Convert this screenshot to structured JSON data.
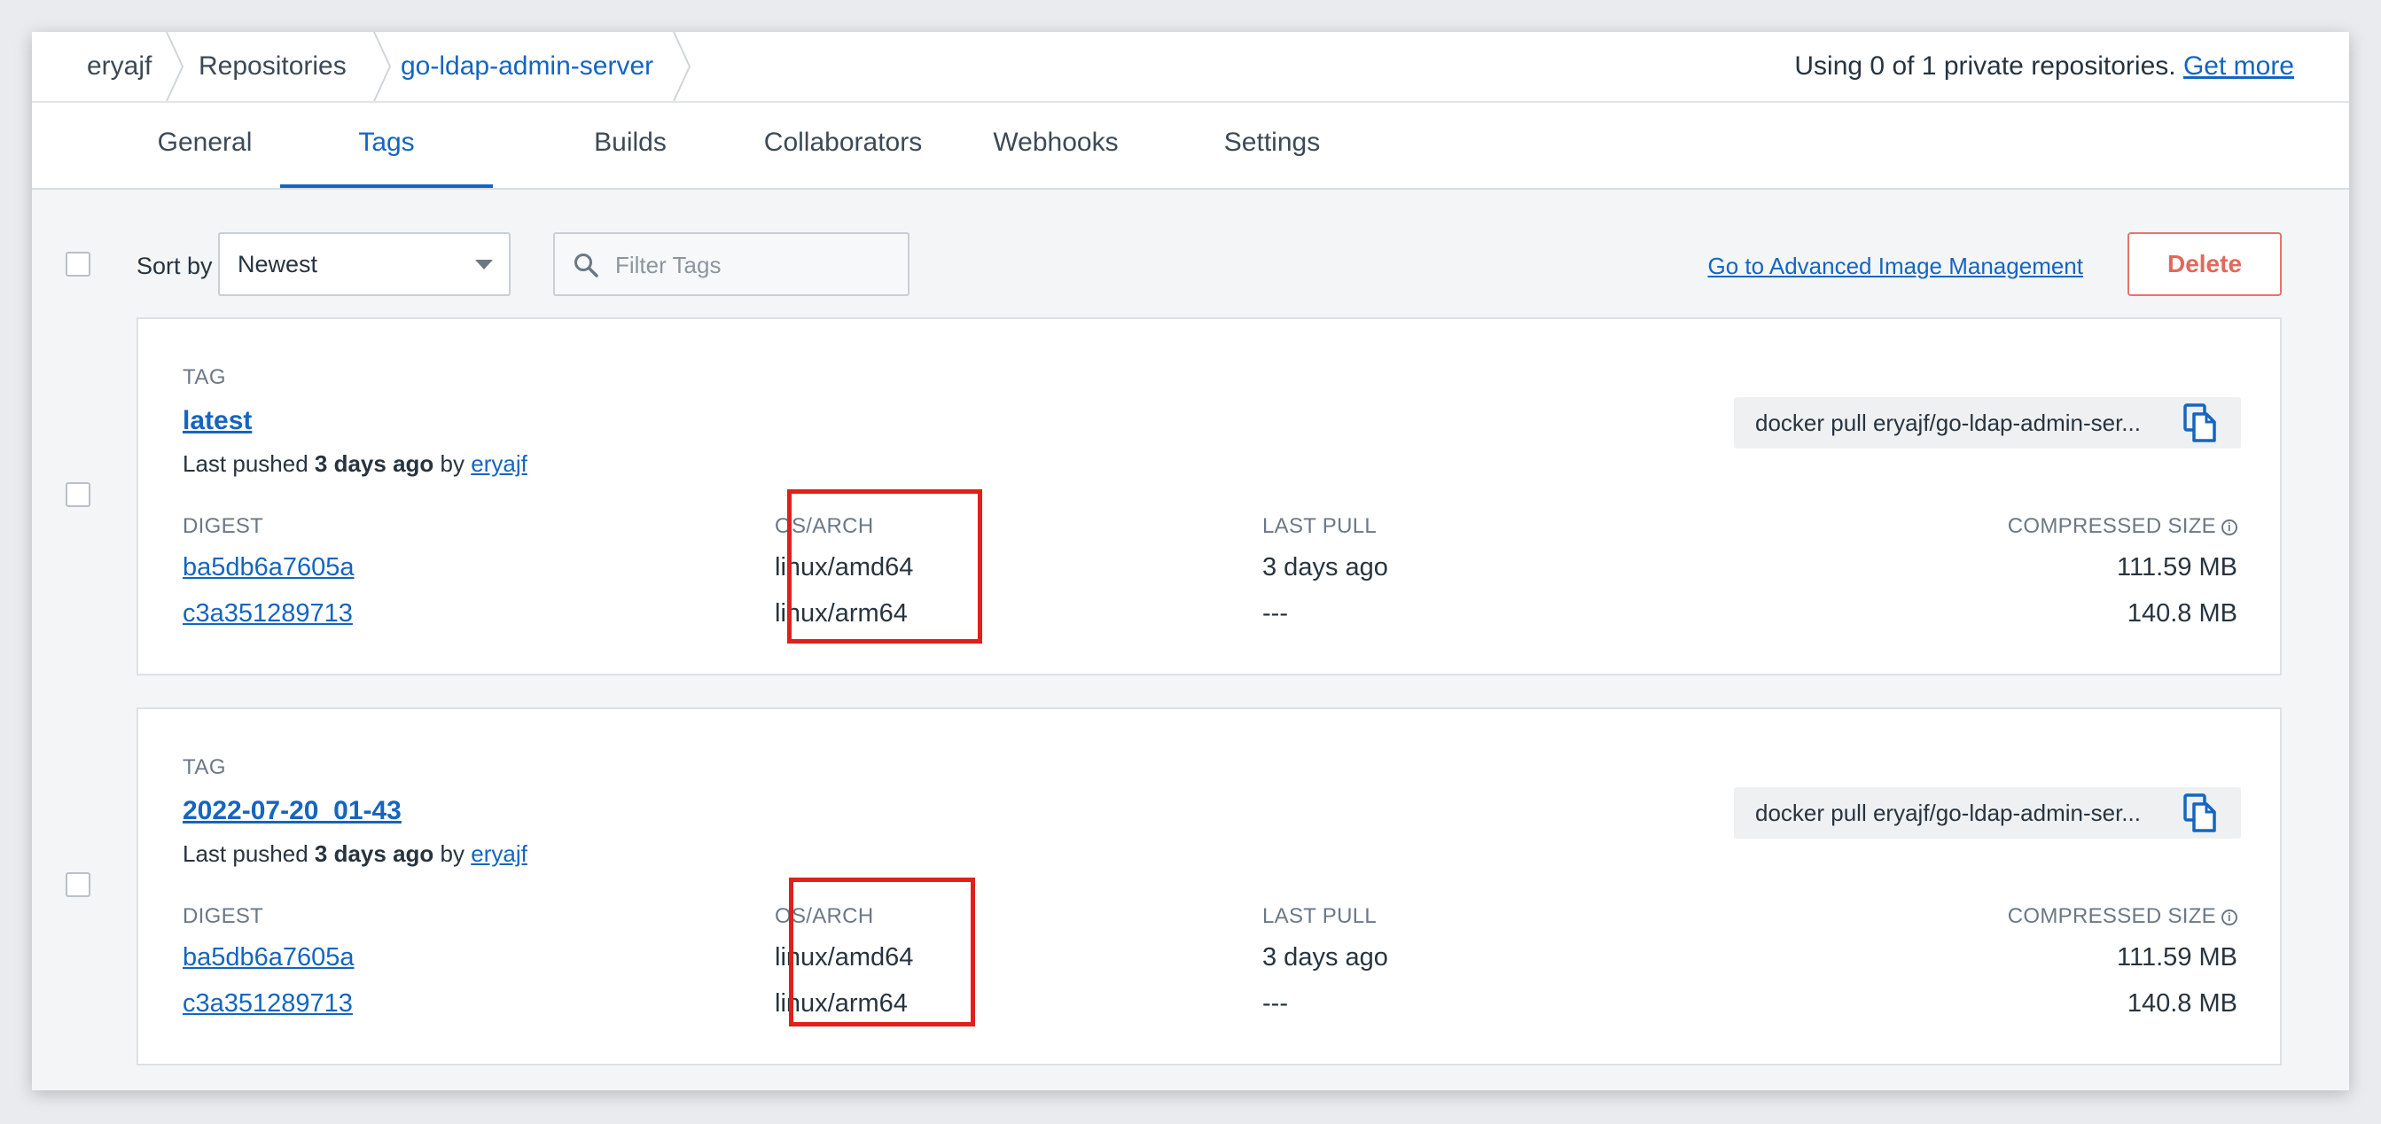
{
  "breadcrumb": {
    "items": [
      "eryajf",
      "Repositories",
      "go-ldap-admin-server"
    ]
  },
  "usage": {
    "text": "Using 0 of 1 private repositories.",
    "link": "Get more"
  },
  "tabs": [
    "General",
    "Tags",
    "Builds",
    "Collaborators",
    "Webhooks",
    "Settings"
  ],
  "active_tab": "Tags",
  "toolbar": {
    "sort_label": "Sort by",
    "sort_value": "Newest",
    "filter_placeholder": "Filter Tags",
    "advanced_link": "Go to Advanced Image Management",
    "delete_label": "Delete"
  },
  "columns": {
    "tag": "TAG",
    "digest": "DIGEST",
    "osarch": "OS/ARCH",
    "last_pull": "LAST PULL",
    "size": "COMPRESSED SIZE"
  },
  "tags": [
    {
      "name": "latest",
      "pushed_prefix": "Last pushed",
      "pushed_when": "3 days ago",
      "pushed_by_prefix": "by",
      "pushed_by": "eryajf",
      "pull_command": "docker pull eryajf/go-ldap-admin-ser...",
      "rows": [
        {
          "digest": "ba5db6a7605a",
          "osarch": "linux/amd64",
          "last_pull": "3 days ago",
          "size": "111.59 MB"
        },
        {
          "digest": "c3a351289713",
          "osarch": "linux/arm64",
          "last_pull": "---",
          "size": "140.8 MB"
        }
      ]
    },
    {
      "name": "2022-07-20_01-43",
      "pushed_prefix": "Last pushed",
      "pushed_when": "3 days ago",
      "pushed_by_prefix": "by",
      "pushed_by": "eryajf",
      "pull_command": "docker pull eryajf/go-ldap-admin-ser...",
      "rows": [
        {
          "digest": "ba5db6a7605a",
          "osarch": "linux/amd64",
          "last_pull": "3 days ago",
          "size": "111.59 MB"
        },
        {
          "digest": "c3a351289713",
          "osarch": "linux/arm64",
          "last_pull": "---",
          "size": "140.8 MB"
        }
      ]
    }
  ],
  "colors": {
    "accent": "#1565c0",
    "danger": "#e0695d",
    "highlight": "#e0201a"
  }
}
